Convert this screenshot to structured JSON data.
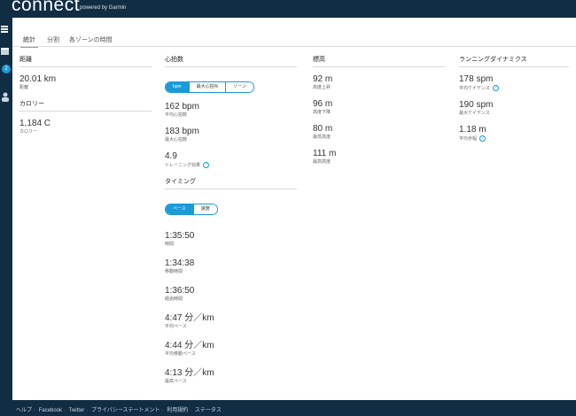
{
  "header": {
    "logo": "connect",
    "powered": "powered by Garmin"
  },
  "rail": {
    "badge": "2"
  },
  "tabs": [
    "統計",
    "分割",
    "各ゾーンの時間"
  ],
  "distance": {
    "title": "距離",
    "value": "20.01 km",
    "label": "距離"
  },
  "calories": {
    "title": "カロリー",
    "value": "1,184 C",
    "label": "カロリー"
  },
  "heart": {
    "title": "心拍数",
    "toggle": [
      "bpm",
      "最大心拍%",
      "ゾーン"
    ],
    "avg_value": "162 bpm",
    "avg_label": "平均心拍数",
    "max_value": "183 bpm",
    "max_label": "最大心拍数",
    "te_value": "4.9",
    "te_label": "トレーニング効果"
  },
  "timing": {
    "title": "タイミング",
    "toggle": [
      "ペース",
      "速度"
    ],
    "items": [
      {
        "value": "1:35:50",
        "label": "時間"
      },
      {
        "value": "1:34:38",
        "label": "移動時間"
      },
      {
        "value": "1:36:50",
        "label": "経過時間"
      },
      {
        "value": "4:47 分／km",
        "label": "平均ペース"
      },
      {
        "value": "4:44 分／km",
        "label": "平均移動ペース"
      },
      {
        "value": "4:13 分／km",
        "label": "最高ペース"
      }
    ]
  },
  "elevation": {
    "title": "標高",
    "items": [
      {
        "value": "92 m",
        "label": "高度上昇"
      },
      {
        "value": "96 m",
        "label": "高度下降"
      },
      {
        "value": "80 m",
        "label": "最低高度"
      },
      {
        "value": "111 m",
        "label": "最高高度"
      }
    ]
  },
  "dynamics": {
    "title": "ランニングダイナミクス",
    "items": [
      {
        "value": "178 spm",
        "label": "平均ケイデンス"
      },
      {
        "value": "190 spm",
        "label": "最大ケイデンス"
      },
      {
        "value": "1.18 m",
        "label": "平均歩幅"
      }
    ]
  },
  "footer": {
    "links": [
      "ヘルプ",
      "Facebook",
      "Twitter",
      "プライバシーステートメント",
      "利用規約",
      "ステータス"
    ]
  },
  "colors": {
    "brand_dark": "#112d44",
    "accent": "#1b9ad8"
  }
}
